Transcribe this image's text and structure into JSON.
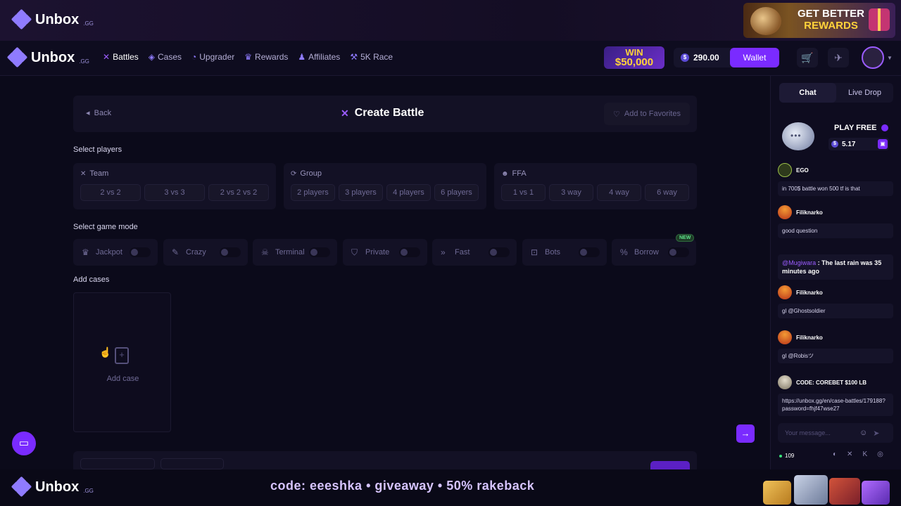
{
  "brand": {
    "name": "Unbox",
    "suffix": ".GG"
  },
  "promo_top": {
    "line1": "GET BETTER",
    "line2": "REWARDS"
  },
  "nav": {
    "links": [
      {
        "label": "Battles",
        "icon": "swords-icon"
      },
      {
        "label": "Cases",
        "icon": "cases-icon"
      },
      {
        "label": "Upgrader",
        "icon": "upgrader-icon"
      },
      {
        "label": "Rewards",
        "icon": "trophy-icon"
      },
      {
        "label": "Affiliates",
        "icon": "affiliates-icon"
      },
      {
        "label": "5K Race",
        "icon": "race-icon"
      }
    ],
    "win_badge": {
      "line1": "WIN",
      "line2": "$50,000"
    },
    "balance": "290.00",
    "wallet_label": "Wallet"
  },
  "battle": {
    "back_label": "Back",
    "title": "Create Battle",
    "favorites_label": "Add to Favorites",
    "select_players_label": "Select players",
    "groups": [
      {
        "title": "Team",
        "options": [
          "2 vs 2",
          "3 vs 3",
          "2 vs 2 vs 2"
        ]
      },
      {
        "title": "Group",
        "options": [
          "2 players",
          "3 players",
          "4 players",
          "6 players"
        ]
      },
      {
        "title": "FFA",
        "options": [
          "1 vs 1",
          "3 way",
          "4 way",
          "6 way"
        ]
      }
    ],
    "select_mode_label": "Select game mode",
    "modes": [
      "Jackpot",
      "Crazy",
      "Terminal",
      "Private",
      "Fast",
      "Bots",
      "Borrow"
    ],
    "new_badge": "NEW",
    "add_cases_label": "Add cases",
    "add_case_label": "Add case"
  },
  "panel": {
    "tabs": [
      "Chat",
      "Live Drop"
    ],
    "play_free": {
      "title": "PLAY FREE",
      "value": "5.17"
    },
    "messages": [
      {
        "name": "EGO",
        "text": "in 700$ battle won 500 tf is that",
        "avatar_color": "#2e3a1c"
      },
      {
        "name": "Filiknarko",
        "text": "good question",
        "avatar_color": "#d9531e"
      },
      {
        "name": "Filiknarko",
        "text": "gl @Ghostsoldier",
        "avatar_color": "#d9531e"
      },
      {
        "name": "Filiknarko",
        "text": "gl @Robisツ",
        "avatar_color": "#d9531e"
      },
      {
        "name": "CODE: COREBET $100 LB",
        "text": "https://unbox.gg/en/case-battles/179188?password=fhjf47wse27",
        "avatar_color": "#b9b4a6"
      }
    ],
    "rain": {
      "mention": "@Mugiwara",
      "text": " : The last rain was 35 minutes ago"
    },
    "chat_placeholder": "Your message...",
    "online_count": "109"
  },
  "promo_bottom": {
    "text": "code: eeeshka  •  giveaway  •  50% rakeback"
  },
  "colors": {
    "accent": "#7a2bff",
    "background": "#0b0a1a",
    "card": "#131125"
  }
}
